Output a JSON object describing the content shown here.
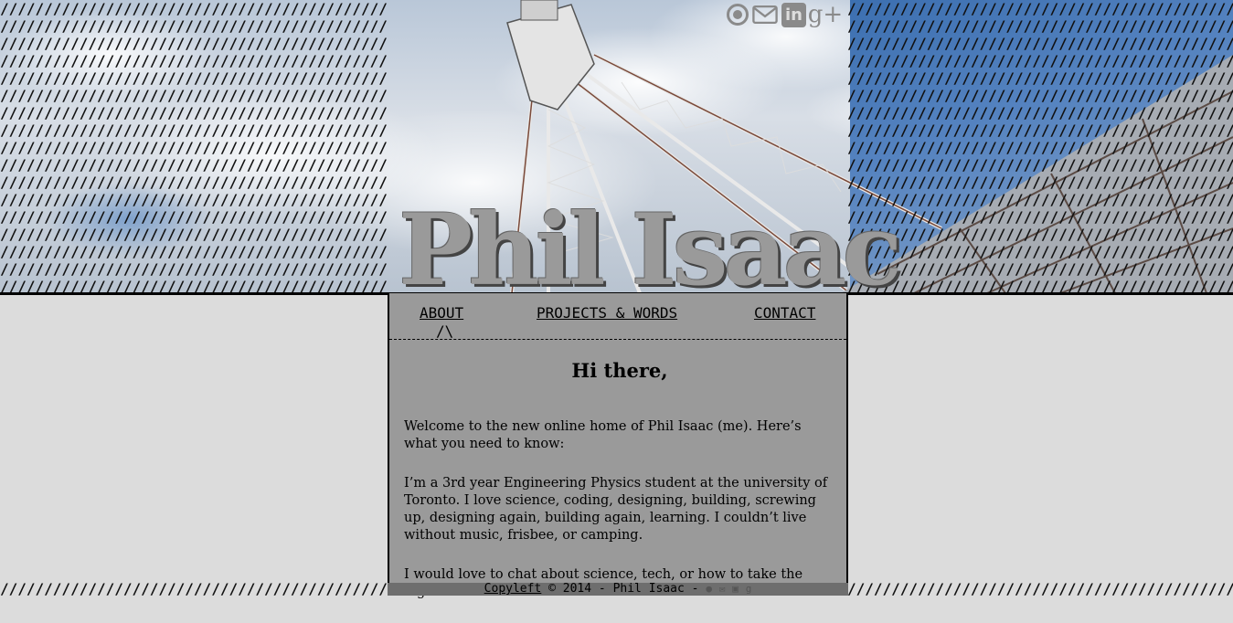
{
  "header": {
    "title": "Phil Isaac",
    "slash_row": "////////////////////////////////////////////"
  },
  "social": {
    "icons": [
      "github-icon",
      "mail-icon",
      "linkedin-icon",
      "google-plus-icon"
    ],
    "linkedin_text": "in",
    "google_plus_text": "g+"
  },
  "nav": {
    "about": "ABOUT",
    "projects": "PROJECTS & WORDS",
    "contact": "CONTACT",
    "active_marker": "/\\"
  },
  "content": {
    "heading": "Hi there,",
    "paragraphs": [
      "Welcome to the new online home of Phil Isaac (me). Here’s what you need to know:",
      "I’m a 3rd year Engineering Physics student at the university of Toronto. I love science, coding, designing, building, screwing up, designing again, building again, learning. I couldn’t live without music, frisbee, or camping.",
      "I would love to chat about science, tech, or how to take the highest"
    ]
  },
  "footer": {
    "copyleft": "Copyleft",
    "copyleft_symbol": "©",
    "text": " 2014 - Phil Isaac - "
  },
  "colors": {
    "panel": "#9a9a9a",
    "page": "#dcdcdc",
    "title": "#9a9a9a"
  }
}
